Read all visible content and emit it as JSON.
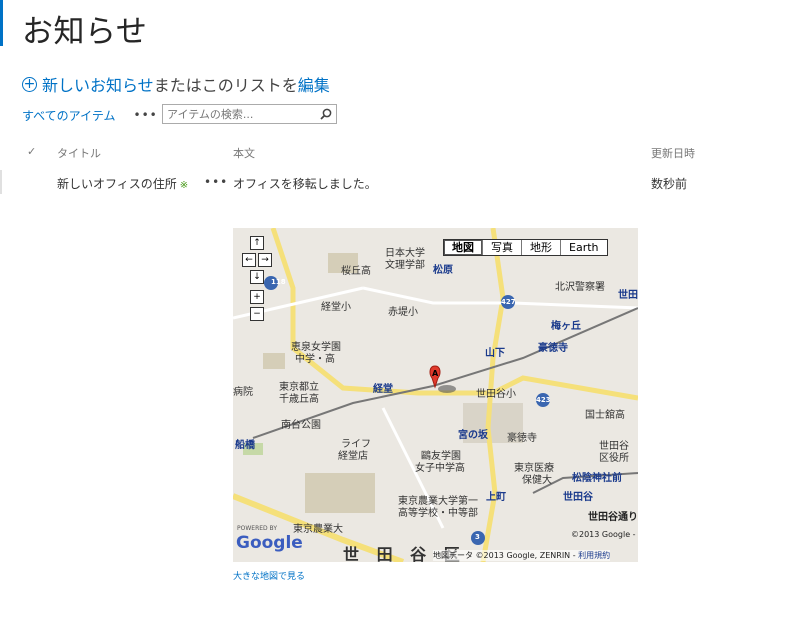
{
  "page": {
    "top_link": "",
    "title": "お知らせ"
  },
  "new_item": {
    "link_label": "新しいお知らせ",
    "middle_text": "またはこのリストを",
    "edit_label": "編集"
  },
  "view": {
    "name": "すべてのアイテム",
    "menu_label": "•••",
    "search_placeholder": "アイテムの検索..."
  },
  "list": {
    "columns": [
      "タイトル",
      "本文",
      "更新日時"
    ],
    "rows": [
      {
        "title": "新しいオフィスの住所",
        "new_marker": "※",
        "menu": "•••",
        "body": "オフィスを移転しました。",
        "modified": "数秒前"
      }
    ]
  },
  "map": {
    "type_buttons": [
      "地図",
      "写真",
      "地形",
      "Earth"
    ],
    "nav": {
      "up": "↑",
      "left": "←",
      "right": "→",
      "down": "↓",
      "zoom_in": "+",
      "zoom_out": "−"
    },
    "labels": [
      "日本大学",
      "文理学部",
      "桜丘高",
      "松原",
      "北沢警察署",
      "世田",
      "梅ヶ丘",
      "豪徳寺",
      "山下",
      "経堂小",
      "赤堤小",
      "恵泉女学園",
      "中学・高",
      "東京都立",
      "千歳丘高",
      "経堂",
      "世田谷小",
      "南台公園",
      "宮の坂",
      "豪徳寺",
      "国士舘高",
      "世田谷",
      "区役所",
      "船橋",
      "ライフ",
      "経堂店",
      "鷗友学園",
      "女子中学高",
      "東京医療",
      "保健大",
      "松陰神社前",
      "東京農業大学第一",
      "高等学校・中等部",
      "上町",
      "世田谷",
      "世田谷通り",
      "東京農業大",
      "病院"
    ],
    "route_numbers": [
      "118",
      "427",
      "423",
      "3"
    ],
    "ward_name": "世 田 谷 区",
    "powered_by": "POWERED BY",
    "google": "Google",
    "copyright": "©2013 Google -",
    "attribution": "地図データ ©2013 Google, ZENRIN -",
    "terms": "利用規約",
    "marker_letter": "A"
  },
  "big_map_link": "大きな地図で見る",
  "colors": {
    "accent": "#0072c6",
    "new_marker": "#4a9b1c",
    "road_major": "#f5e07a",
    "road_minor": "#ffffff",
    "park": "#c6d9a7",
    "map_bg": "#ebe8e2",
    "marker": "#e03a2c"
  }
}
